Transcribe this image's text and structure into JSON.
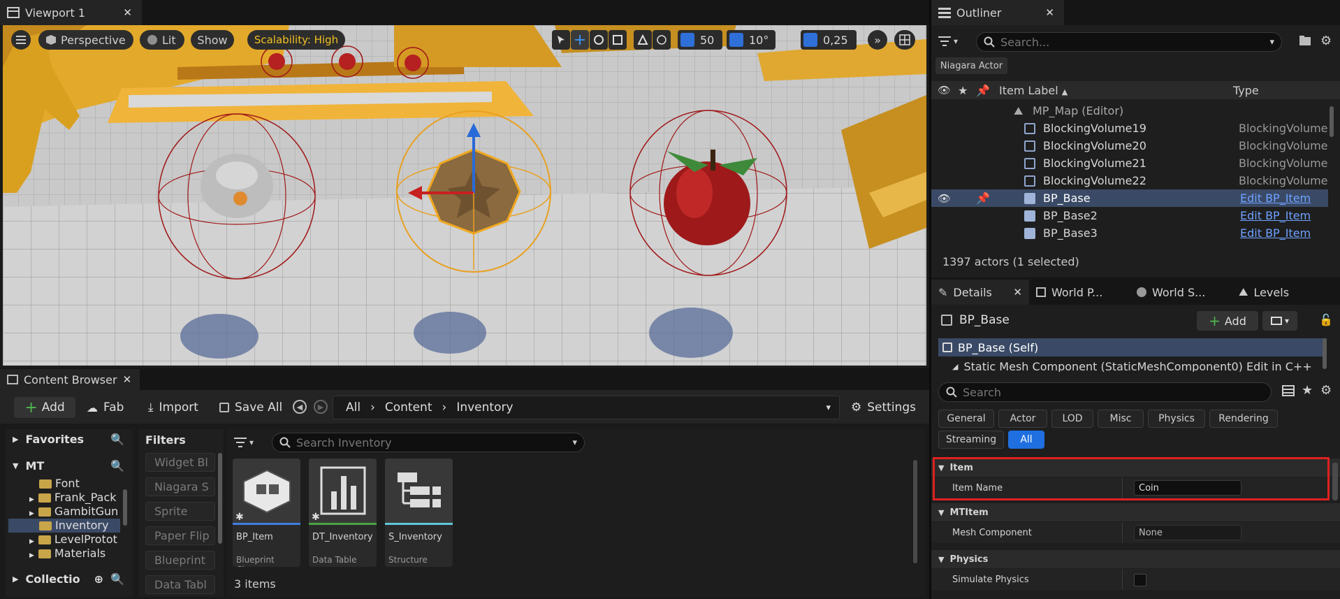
{
  "viewport": {
    "tab_title": "Viewport 1",
    "perspective_label": "Perspective",
    "lit_label": "Lit",
    "show_label": "Show",
    "scalability_label": "Scalability: High",
    "grid_snap_value": "50",
    "rotation_snap_value": "10°",
    "scale_snap_value": "0,25"
  },
  "outliner": {
    "tab_title": "Outliner",
    "search_placeholder": "Search...",
    "filter_chip": "Niagara Actor",
    "col_item_label": "Item Label",
    "col_type": "Type",
    "map_row": "MP_Map (Editor)",
    "rows": [
      {
        "label": "BlockingVolume19",
        "type": "BlockingVolume"
      },
      {
        "label": "BlockingVolume20",
        "type": "BlockingVolume"
      },
      {
        "label": "BlockingVolume21",
        "type": "BlockingVolume"
      },
      {
        "label": "BlockingVolume22",
        "type": "BlockingVolume"
      },
      {
        "label": "BP_Base",
        "type": "Edit BP_Item"
      },
      {
        "label": "BP_Base2",
        "type": "Edit BP_Item"
      },
      {
        "label": "BP_Base3",
        "type": "Edit BP_Item"
      }
    ],
    "status": "1397 actors (1 selected)"
  },
  "details": {
    "tabs": [
      "Details",
      "World P...",
      "World S...",
      "Levels"
    ],
    "actor_name": "BP_Base",
    "add_label": "Add",
    "component_self": "BP_Base (Self)",
    "component_child": "Static Mesh Component (StaticMeshComponent0)  Edit in C++",
    "search_placeholder": "Search",
    "filter_chips": [
      "General",
      "Actor",
      "LOD",
      "Misc",
      "Physics",
      "Rendering",
      "Streaming",
      "All"
    ],
    "sections": {
      "item_header": "Item",
      "item_name_label": "Item Name",
      "item_name_value": "Coin",
      "mtitem_header": "MTItem",
      "mesh_label": "Mesh Component",
      "mesh_value": "None",
      "physics_header": "Physics",
      "simulate_label": "Simulate Physics"
    },
    "highlight_color": "#e02020"
  },
  "content_browser": {
    "tab_title": "Content Browser",
    "add_label": "Add",
    "fab_label": "Fab",
    "import_label": "Import",
    "save_all_label": "Save All",
    "breadcrumb": [
      "All",
      "Content",
      "Inventory"
    ],
    "settings_label": "Settings",
    "favorites_label": "Favorites",
    "project_label": "MT",
    "folders": [
      "Font",
      "Frank_Pack",
      "GambitGun",
      "Inventory",
      "LevelProtot",
      "Materials"
    ],
    "collections_label": "Collectio",
    "filters_title": "Filters",
    "filters": [
      "Widget Bl",
      "Niagara S",
      "Sprite",
      "Paper Flip",
      "Blueprint",
      "Data Tabl"
    ],
    "search_placeholder": "Search Inventory",
    "assets": [
      {
        "name": "BP_Item",
        "type": "Blueprint Class",
        "color": "#3f7de0"
      },
      {
        "name": "DT_Inventory",
        "type": "Data Table",
        "color": "#4aa342"
      },
      {
        "name": "S_Inventory",
        "type": "Structure",
        "color": "#5fc7d6"
      }
    ],
    "item_count": "3 items"
  }
}
